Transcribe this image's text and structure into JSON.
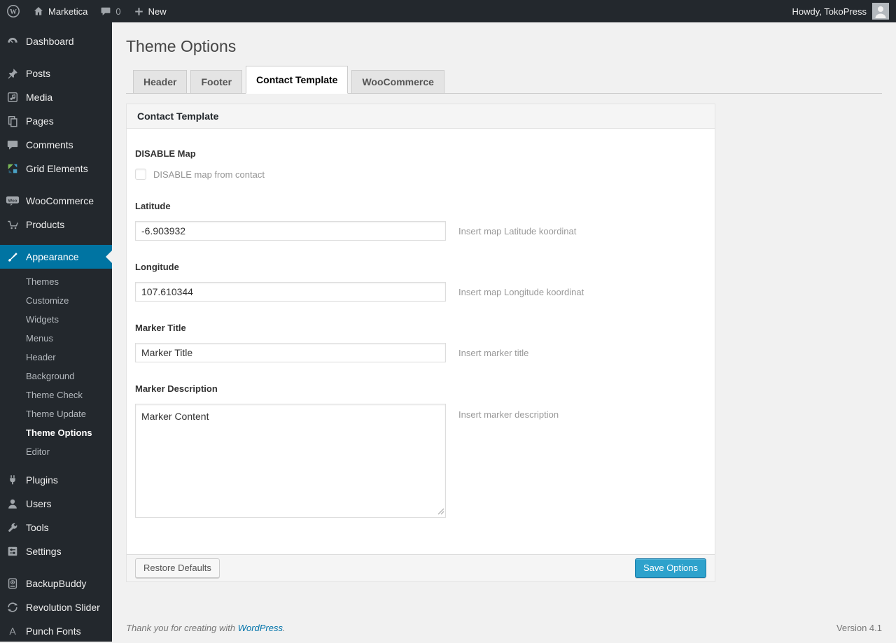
{
  "admin_bar": {
    "site_name": "Marketica",
    "comment_count": "0",
    "new_label": "New",
    "howdy": "Howdy, TokoPress"
  },
  "sidebar": {
    "items": [
      {
        "label": "Dashboard",
        "icon": "dashboard-icon"
      },
      {
        "label": "Posts",
        "icon": "pushpin-icon"
      },
      {
        "label": "Media",
        "icon": "media-icon"
      },
      {
        "label": "Pages",
        "icon": "pages-icon"
      },
      {
        "label": "Comments",
        "icon": "comment-icon"
      },
      {
        "label": "Grid Elements",
        "icon": "grid-icon"
      },
      {
        "label": "WooCommerce",
        "icon": "woo-badge-icon"
      },
      {
        "label": "Products",
        "icon": "cart-icon"
      },
      {
        "label": "Appearance",
        "icon": "paintbrush-icon",
        "active": true
      },
      {
        "label": "Plugins",
        "icon": "plug-icon"
      },
      {
        "label": "Users",
        "icon": "user-icon"
      },
      {
        "label": "Tools",
        "icon": "wrench-icon"
      },
      {
        "label": "Settings",
        "icon": "sliders-icon"
      },
      {
        "label": "BackupBuddy",
        "icon": "backup-icon"
      },
      {
        "label": "Revolution Slider",
        "icon": "refresh-icon"
      },
      {
        "label": "Punch Fonts",
        "icon": "letter-a-icon"
      }
    ],
    "appearance_submenu": [
      "Themes",
      "Customize",
      "Widgets",
      "Menus",
      "Header",
      "Background",
      "Theme Check",
      "Theme Update",
      "Theme Options",
      "Editor"
    ],
    "current_submenu_item": "Theme Options"
  },
  "main": {
    "page_title": "Theme Options",
    "tabs": [
      {
        "label": "Header"
      },
      {
        "label": "Footer"
      },
      {
        "label": "Contact Template",
        "active": true
      },
      {
        "label": "WooCommerce"
      }
    ],
    "panel": {
      "title": "Contact Template",
      "fields": {
        "disable_map": {
          "label": "DISABLE Map",
          "checkbox_label": "DISABLE map from contact",
          "checked": false
        },
        "latitude": {
          "label": "Latitude",
          "value": "-6.903932",
          "hint": "Insert map Latitude koordinat"
        },
        "longitude": {
          "label": "Longitude",
          "value": "107.610344",
          "hint": "Insert map Longitude koordinat"
        },
        "marker_title": {
          "label": "Marker Title",
          "value": "Marker Title",
          "hint": "Insert marker title"
        },
        "marker_description": {
          "label": "Marker Description",
          "value": "Marker Content",
          "hint": "Insert marker description"
        }
      },
      "actions": {
        "restore": "Restore Defaults",
        "save": "Save Options"
      }
    },
    "footer": {
      "thanks_prefix": "Thank you for creating with",
      "wordpress_link": "WordPress",
      "suffix": ".",
      "version": "Version 4.1"
    }
  },
  "colors": {
    "accent_active_menu": "#0074a2",
    "primary_button": "#2ea2cc",
    "link": "#0073aa",
    "admin_dark": "#23282d",
    "content_bg": "#f1f1f1"
  }
}
